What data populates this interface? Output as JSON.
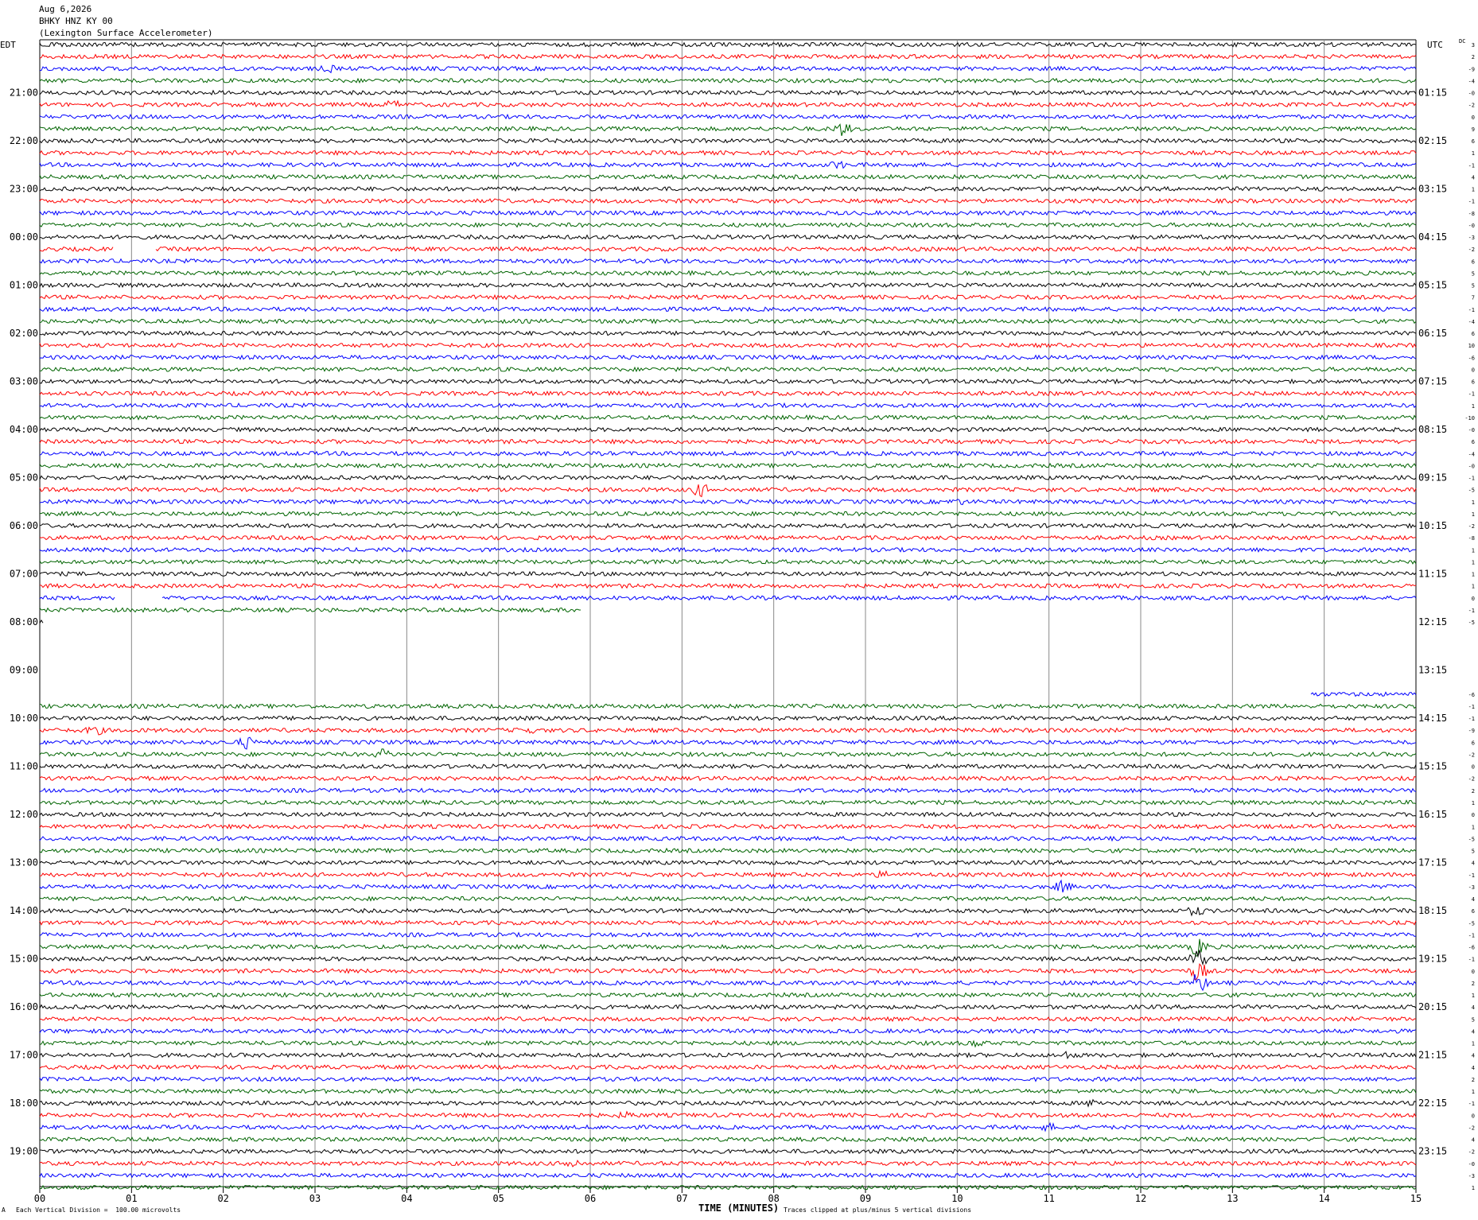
{
  "header": {
    "date": "Aug 6,2026",
    "station": "BHKY HNZ KY 00",
    "description": "(Lexington Surface Accelerometer)"
  },
  "left_timezone": "EDT",
  "right_timezone": "UTC",
  "dc_label": "DC",
  "footer": {
    "scale_note": "Each Vertical Division =  100.00 microvolts",
    "clip_note": "Traces clipped at plus/minus 5 vertical divisions",
    "corner_mark": "A"
  },
  "chart_data": {
    "type": "helicorder",
    "xlabel": "TIME (MINUTES)",
    "x_range": [
      0,
      15
    ],
    "x_ticks": [
      "00",
      "01",
      "02",
      "03",
      "04",
      "05",
      "06",
      "07",
      "08",
      "09",
      "10",
      "11",
      "12",
      "13",
      "14",
      "15"
    ],
    "trace_interval_minutes": 15,
    "trace_colors": [
      "#000000",
      "#ff0000",
      "#0000ff",
      "#006400"
    ],
    "left_hour_labels": [
      "21:00",
      "22:00",
      "23:00",
      "00:00",
      "01:00",
      "02:00",
      "03:00",
      "04:00",
      "05:00",
      "06:00",
      "07:00",
      "08:00",
      "09:00",
      "10:00",
      "11:00",
      "12:00",
      "13:00",
      "14:00",
      "15:00",
      "16:00",
      "17:00",
      "18:00",
      "19:00"
    ],
    "right_hour_labels": [
      "01:15",
      "02:15",
      "03:15",
      "04:15",
      "05:15",
      "06:15",
      "07:15",
      "08:15",
      "09:15",
      "10:15",
      "11:15",
      "12:15",
      "13:15",
      "14:15",
      "15:15",
      "16:15",
      "17:15",
      "18:15",
      "19:15",
      "20:15",
      "21:15",
      "22:15",
      "23:15"
    ],
    "dc_offsets_top": [
      "3",
      "2",
      "-9",
      "-4",
      "-0",
      "-2",
      "0",
      "9",
      "6",
      "1",
      "-1",
      "4",
      "1",
      "-1",
      "-8",
      "-0",
      "-3",
      "-2",
      "6",
      "5",
      "5",
      "7",
      "-1",
      "-4",
      "6",
      "10",
      "-6",
      "0",
      "6",
      "-1",
      "1",
      "-10",
      "-0",
      "6",
      "-4",
      "-0",
      "-1",
      "-5",
      "1",
      "1",
      "-2",
      "-8",
      "1",
      "1",
      "1",
      "1",
      "0",
      "-1",
      "-5"
    ],
    "dc_offsets_bottom": [
      "-6",
      "-1",
      "-1",
      "-9",
      "6",
      "-2",
      "0",
      "-2",
      "2",
      "1",
      "0",
      "1",
      "-5",
      "5",
      "4",
      "-1",
      "-3",
      "4",
      "6",
      "-5",
      "-1",
      "-6",
      "-1",
      "0",
      "2",
      "1",
      "4",
      "5",
      "4",
      "1",
      "4",
      "4",
      "2",
      "1",
      "-1",
      "0",
      "-2",
      "4",
      "-2",
      "-0",
      "-3",
      "1"
    ],
    "gaps": [
      {
        "trace": 17,
        "start_min": 0.8,
        "end_min": 1.25
      },
      {
        "trace": 46,
        "start_min": 0.82,
        "end_min": 1.33
      },
      {
        "trace": 47,
        "start_min": 5.9,
        "end_min": 15
      },
      {
        "trace": 48,
        "start_min": 0.05,
        "end_min": 15
      },
      {
        "trace": 49,
        "start_min": 0,
        "end_min": 15
      },
      {
        "trace": 50,
        "start_min": 0,
        "end_min": 15
      },
      {
        "trace": 51,
        "start_min": 0,
        "end_min": 15
      },
      {
        "trace": 52,
        "start_min": 0,
        "end_min": 15
      },
      {
        "trace": 53,
        "start_min": 0,
        "end_min": 15
      },
      {
        "trace": 54,
        "start_min": 0,
        "end_min": 13.85
      }
    ],
    "events": [
      {
        "trace": 2,
        "minute": 3.15,
        "amp": 1.2
      },
      {
        "trace": 5,
        "minute": 3.85,
        "amp": 1.5
      },
      {
        "trace": 7,
        "minute": 8.75,
        "amp": 3.0
      },
      {
        "trace": 10,
        "minute": 8.7,
        "amp": 1.5
      },
      {
        "trace": 37,
        "minute": 7.2,
        "amp": 3.0
      },
      {
        "trace": 38,
        "minute": 10.0,
        "amp": 1.0
      },
      {
        "trace": 57,
        "minute": 0.6,
        "amp": 2.0
      },
      {
        "trace": 57,
        "minute": 5.3,
        "amp": 1.4
      },
      {
        "trace": 58,
        "minute": 2.25,
        "amp": 2.5
      },
      {
        "trace": 59,
        "minute": 3.75,
        "amp": 2.0
      },
      {
        "trace": 69,
        "minute": 9.2,
        "amp": 1.2
      },
      {
        "trace": 70,
        "minute": 11.15,
        "amp": 2.5
      },
      {
        "trace": 72,
        "minute": 12.6,
        "amp": 2.0
      },
      {
        "trace": 75,
        "minute": 12.63,
        "amp": 5.0
      },
      {
        "trace": 76,
        "minute": 12.63,
        "amp": 5.0
      },
      {
        "trace": 77,
        "minute": 12.63,
        "amp": 5.0
      },
      {
        "trace": 78,
        "minute": 12.63,
        "amp": 5.0
      },
      {
        "trace": 83,
        "minute": 10.2,
        "amp": 1.5
      },
      {
        "trace": 84,
        "minute": 11.2,
        "amp": 1.3
      },
      {
        "trace": 88,
        "minute": 11.5,
        "amp": 1.5
      },
      {
        "trace": 89,
        "minute": 6.4,
        "amp": 1.3
      },
      {
        "trace": 90,
        "minute": 11.0,
        "amp": 1.3
      },
      {
        "trace": 93,
        "minute": 5.8,
        "amp": 2.2
      }
    ]
  }
}
